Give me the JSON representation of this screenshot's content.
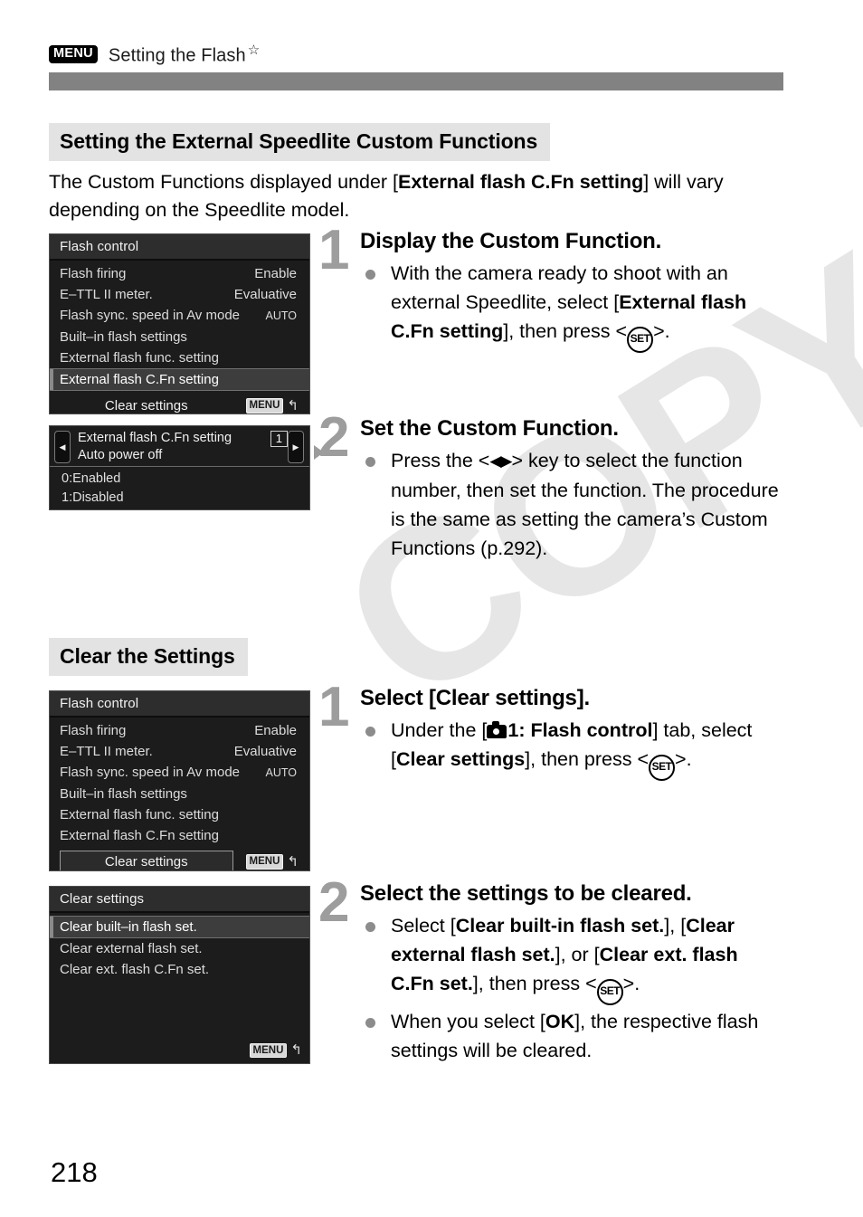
{
  "header": {
    "menu_badge": "MENU",
    "title": "Setting the Flash",
    "star": "☆"
  },
  "sections": {
    "external_cfn": {
      "title": "Setting the External Speedlite Custom Functions",
      "intro_part1": "The Custom Functions displayed under [",
      "intro_bold": "External flash C.Fn setting",
      "intro_part2": "] will vary depending on the Speedlite model."
    },
    "clear_settings": {
      "title": "Clear the Settings"
    }
  },
  "screens": {
    "flash_control_1": {
      "title": "Flash control",
      "rows": [
        {
          "label": "Flash firing",
          "value": "Enable"
        },
        {
          "label": "E–TTL II meter.",
          "value": "Evaluative"
        },
        {
          "label": "Flash sync. speed in Av mode",
          "value": "AUTO"
        },
        {
          "label": "Built–in flash settings",
          "value": ""
        },
        {
          "label": "External flash func. setting",
          "value": ""
        },
        {
          "label": "External flash C.Fn setting",
          "value": ""
        }
      ],
      "highlighted_index": 5,
      "clear_button": "Clear settings",
      "clear_button_boxed": false,
      "menu_badge": "MENU",
      "return_arrow": "↰"
    },
    "cfn_setting": {
      "title": "External flash C.Fn setting",
      "function_name": "Auto power off",
      "function_number": "1",
      "left_arrow": "◀",
      "right_arrow": "▶",
      "options": [
        "0:Enabled",
        "1:Disabled"
      ]
    },
    "flash_control_2": {
      "title": "Flash control",
      "rows": [
        {
          "label": "Flash firing",
          "value": "Enable"
        },
        {
          "label": "E–TTL II meter.",
          "value": "Evaluative"
        },
        {
          "label": "Flash sync. speed in Av mode",
          "value": "AUTO"
        },
        {
          "label": "Built–in flash settings",
          "value": ""
        },
        {
          "label": "External flash func. setting",
          "value": ""
        },
        {
          "label": "External flash C.Fn setting",
          "value": ""
        }
      ],
      "highlighted_index": -1,
      "clear_button": "Clear settings",
      "clear_button_boxed": true,
      "menu_badge": "MENU",
      "return_arrow": "↰"
    },
    "clear_settings_screen": {
      "title": "Clear settings",
      "rows": [
        {
          "label": "Clear built–in flash set."
        },
        {
          "label": "Clear external flash set."
        },
        {
          "label": "Clear ext. flash C.Fn set."
        }
      ],
      "highlighted_index": 0,
      "menu_badge": "MENU",
      "return_arrow": "↰"
    }
  },
  "steps": {
    "display_custom_function": {
      "number": "1",
      "heading": "Display the Custom Function.",
      "bullet1_a": "With the camera ready to shoot with an external Speedlite, select [",
      "bullet1_bold": "External flash C.Fn setting",
      "bullet1_b": "], then press <",
      "set_label": "SET",
      "bullet1_c": ">."
    },
    "set_custom_function": {
      "number": "2",
      "heading": "Set the Custom Function.",
      "bullet1_a": "Press the <",
      "arrow_keys": "◀▶",
      "bullet1_b": "> key to select the function number, then set the function. The procedure is the same as setting the camera’s Custom Functions (p.292)."
    },
    "select_clear_settings": {
      "number": "1",
      "heading": "Select [Clear settings].",
      "bullet1_a": "Under the [",
      "tab_label": "1: Flash control",
      "bullet1_b": "] tab, select [",
      "bullet1_bold": "Clear settings",
      "bullet1_c": "], then press <",
      "set_label": "SET",
      "bullet1_d": ">."
    },
    "select_settings_to_clear": {
      "number": "2",
      "heading": "Select the settings to be cleared.",
      "bullet1_a": "Select [",
      "bullet1_b1": "Clear built-in flash set.",
      "bullet1_c": "], [",
      "bullet1_b2": "Clear external flash set.",
      "bullet1_d": "], or [",
      "bullet1_b3": "ext. flash C.Fn set.",
      "bullet1_b3_pre": "Clear",
      "bullet1_e": "], then press <",
      "set_label": "SET",
      "bullet1_f": ">.",
      "bullet2_a": "When you select [",
      "bullet2_bold": "OK",
      "bullet2_b": "], the respective flash settings will be cleared."
    }
  },
  "watermark": "COPY",
  "page_number": "218"
}
